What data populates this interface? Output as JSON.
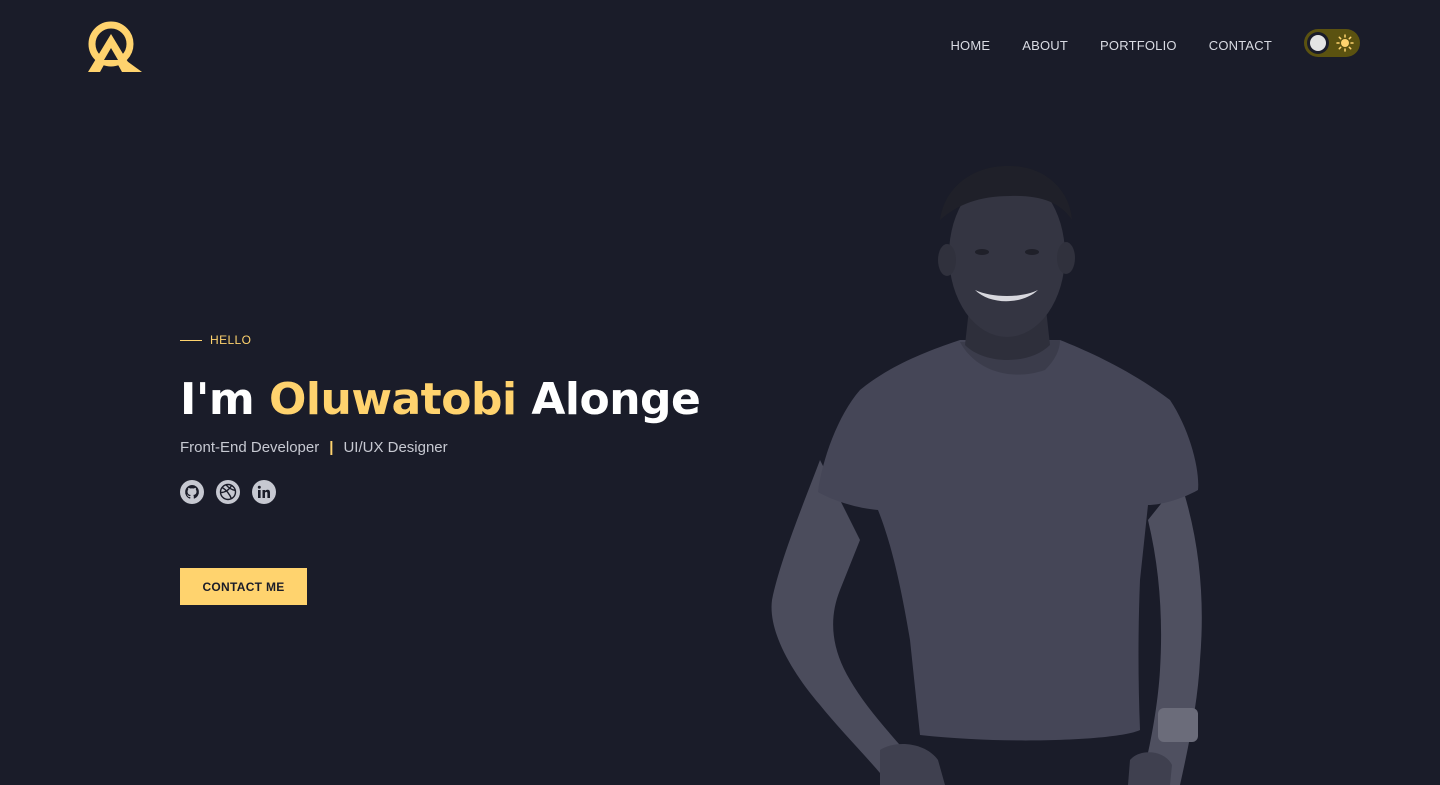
{
  "nav": {
    "items": [
      "HOME",
      "ABOUT",
      "PORTFOLIO",
      "CONTACT"
    ]
  },
  "theme_toggle": {
    "state": "dark",
    "icons": [
      "moon-knob-icon",
      "sun-icon"
    ]
  },
  "hero": {
    "eyebrow": "HELLO",
    "headline_prefix": "I'm",
    "headline_name": "Oluwatobi",
    "headline_suffix": "Alonge",
    "role_1": "Front-End Developer",
    "separator": "|",
    "role_2": "UI/UX Designer",
    "socials": [
      "github-icon",
      "dribbble-icon",
      "linkedin-icon"
    ],
    "cta_label": "CONTACT ME"
  },
  "colors": {
    "background": "#1a1c29",
    "accent": "#ffd36e",
    "text": "#ffffff",
    "muted": "#c7c9d2"
  }
}
